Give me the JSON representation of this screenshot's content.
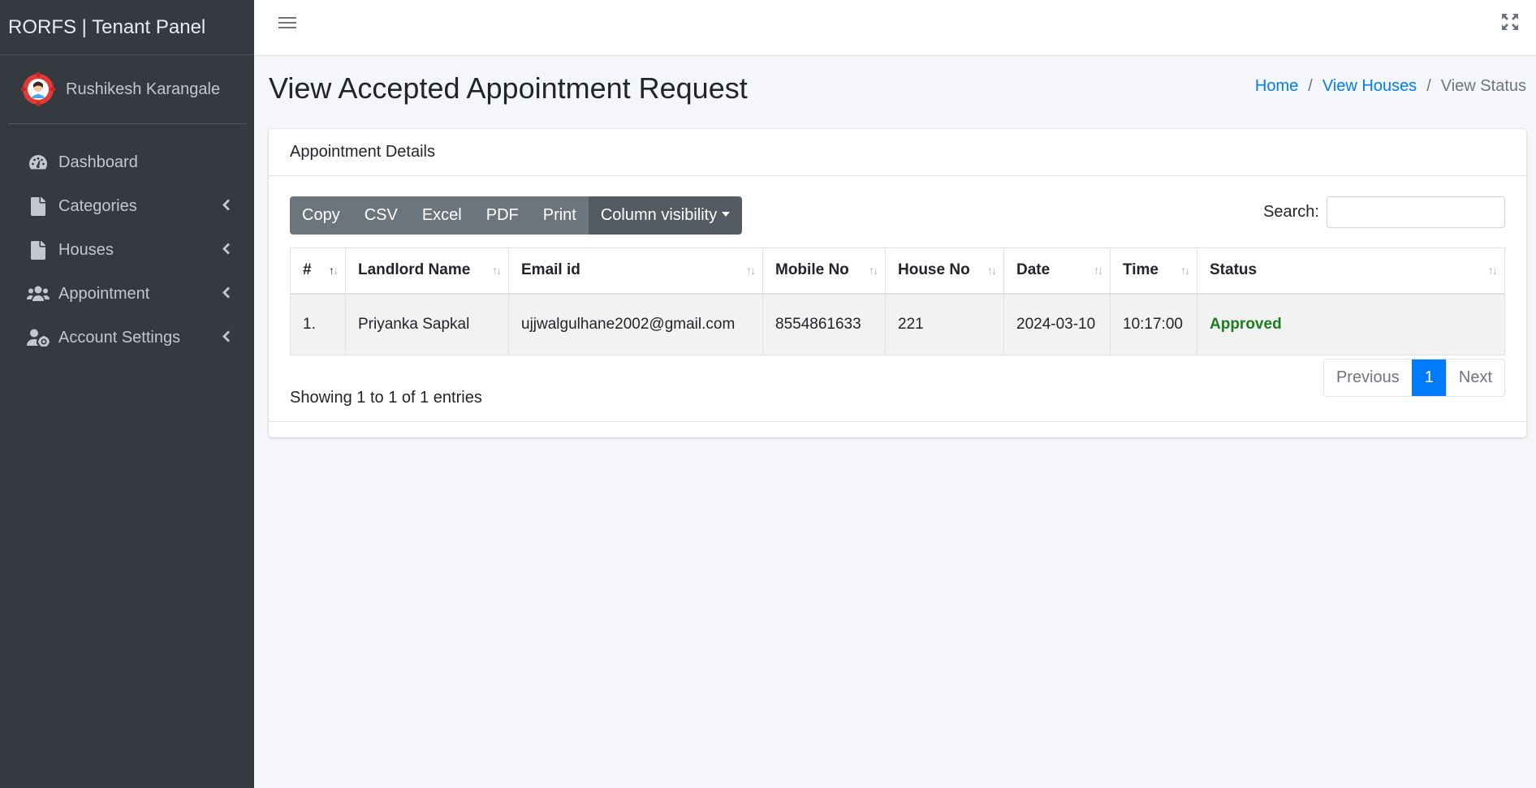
{
  "sidebar": {
    "brand": "RORFS | Tenant Panel",
    "user_name": "Rushikesh Karangale",
    "items": [
      {
        "label": "Dashboard",
        "icon": "tachometer-icon",
        "has_caret": false
      },
      {
        "label": "Categories",
        "icon": "file-icon",
        "has_caret": true
      },
      {
        "label": "Houses",
        "icon": "file-icon",
        "has_caret": true
      },
      {
        "label": "Appointment",
        "icon": "users-icon",
        "has_caret": true
      },
      {
        "label": "Account Settings",
        "icon": "user-cog-icon",
        "has_caret": true
      }
    ]
  },
  "topbar": {
    "menu_icon": "hamburger-icon",
    "fullscreen_icon": "expand-icon"
  },
  "header": {
    "title": "View Accepted Appointment Request",
    "breadcrumb": [
      "Home",
      "View Houses",
      "View Status"
    ]
  },
  "card": {
    "title": "Appointment Details",
    "buttons": [
      "Copy",
      "CSV",
      "Excel",
      "PDF",
      "Print",
      "Column visibility"
    ],
    "search_label": "Search:",
    "search_value": "",
    "columns": [
      "#",
      "Landlord Name",
      "Email id",
      "Mobile No",
      "House No",
      "Date",
      "Time",
      "Status"
    ],
    "rows": [
      [
        "1.",
        "Priyanka Sapkal",
        "ujjwalgulhane2002@gmail.com",
        "8554861633",
        "221",
        "2024-03-10",
        "10:17:00",
        "Approved"
      ]
    ],
    "info": "Showing 1 to 1 of 1 entries",
    "pagination": {
      "previous": "Previous",
      "current": "1",
      "next": "Next"
    }
  },
  "colors": {
    "sidebar_bg": "#343a40",
    "primary": "#007bff",
    "approved": "#1a7f1a",
    "button": "#6c757d"
  }
}
